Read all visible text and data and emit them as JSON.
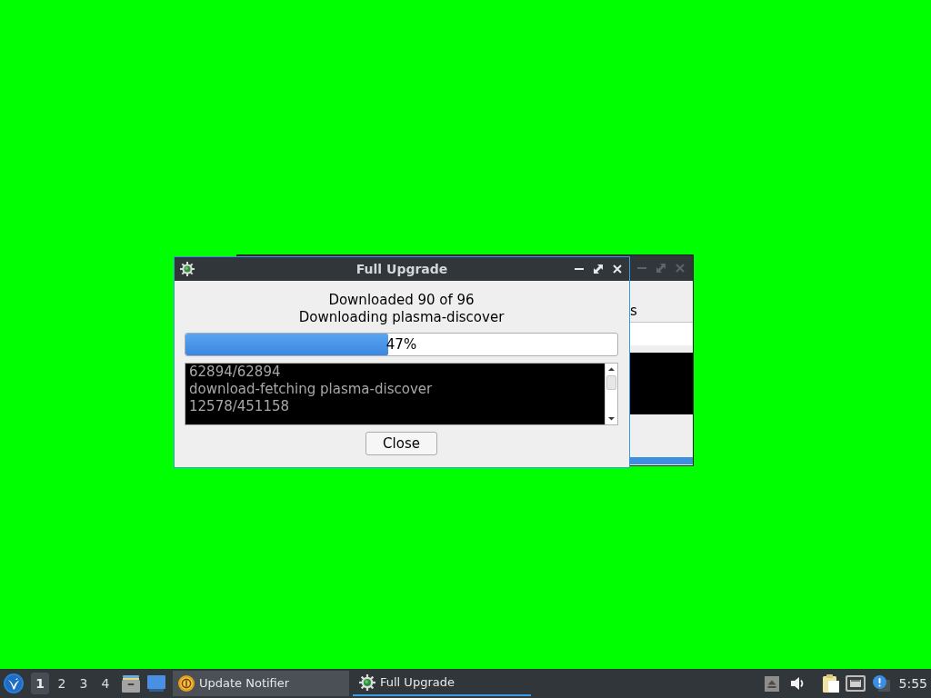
{
  "background_window": {
    "text_fragment": "s"
  },
  "dialog": {
    "title": "Full Upgrade",
    "status_lines": [
      "Downloaded 90 of 96",
      "Downloading plasma-discover"
    ],
    "progress": {
      "level": 0.47,
      "text": "47%"
    },
    "log_lines": [
      "62894/62894",
      "download-fetching plasma-discover",
      "12578/451158"
    ],
    "close_button": "Close"
  },
  "taskbar": {
    "workspaces": [
      {
        "label": "1",
        "selected": true
      },
      {
        "label": "2",
        "selected": false
      },
      {
        "label": "3",
        "selected": false
      },
      {
        "label": "4",
        "selected": false
      }
    ],
    "tasks": [
      {
        "kind": "notifier",
        "label": "Update Notifier",
        "selected": false
      },
      {
        "kind": "upgrade",
        "label": "Full Upgrade",
        "selected": true
      }
    ],
    "clock": "5:55"
  }
}
